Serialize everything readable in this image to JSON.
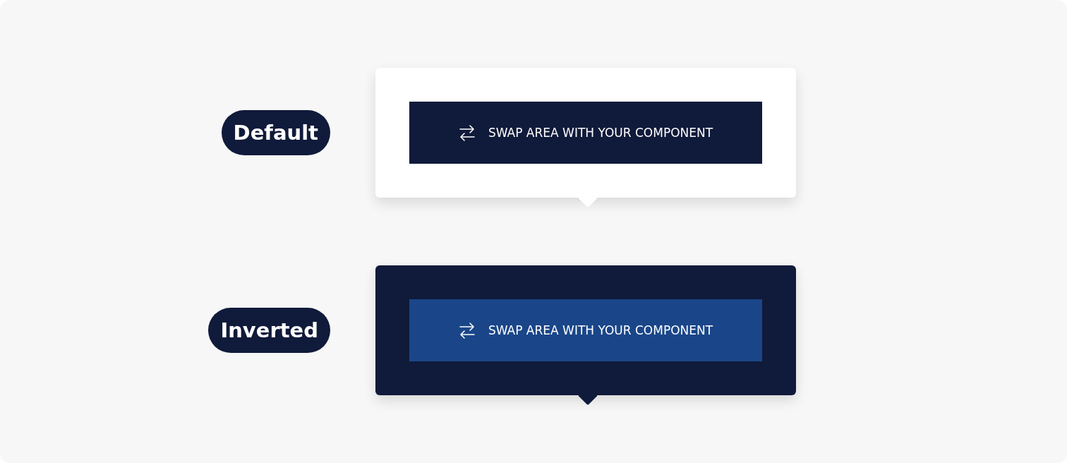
{
  "variants": [
    {
      "label": "Default",
      "kind": "default",
      "swap_text": "SWAP AREA WITH YOUR COMPONENT"
    },
    {
      "label": "Inverted",
      "kind": "inverted",
      "swap_text": "SWAP AREA WITH YOUR COMPONENT"
    }
  ]
}
